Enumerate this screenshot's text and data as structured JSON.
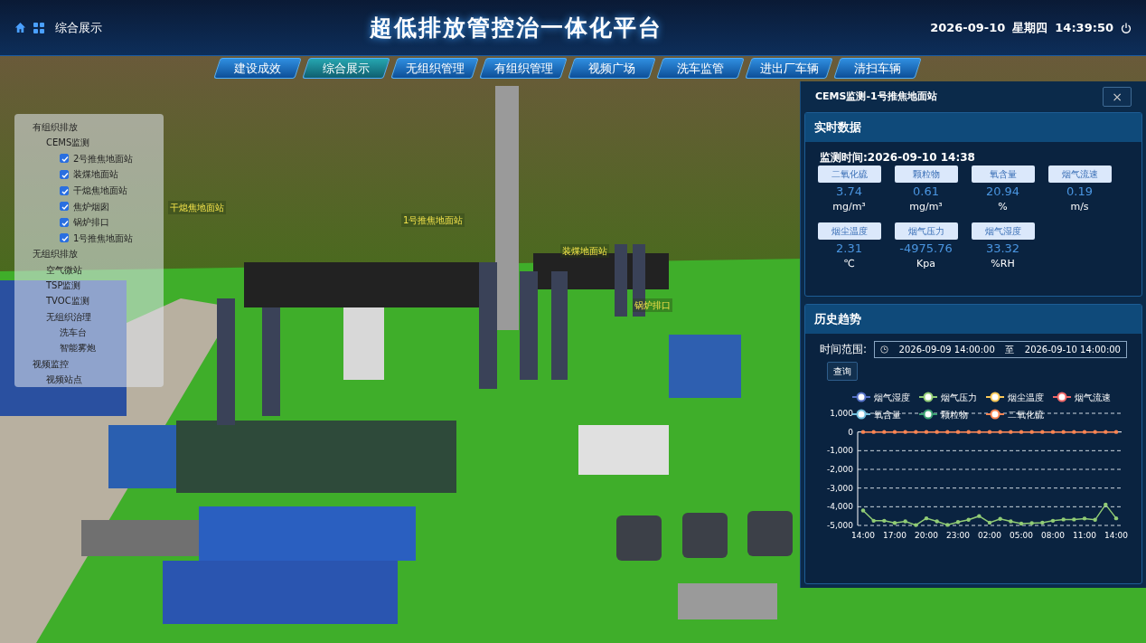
{
  "header": {
    "breadcrumb": "综合展示",
    "title": "超低排放管控治一体化平台",
    "date": "2026-09-10",
    "weekday": "星期四",
    "time": "14:39:50"
  },
  "nav_tabs": [
    {
      "label": "建设成效",
      "selected": false
    },
    {
      "label": "综合展示",
      "selected": true
    },
    {
      "label": "无组织管理",
      "selected": false
    },
    {
      "label": "有组织管理",
      "selected": false
    },
    {
      "label": "视频广场",
      "selected": false
    },
    {
      "label": "洗车监管",
      "selected": false
    },
    {
      "label": "进出厂车辆",
      "selected": false
    },
    {
      "label": "清扫车辆",
      "selected": false
    }
  ],
  "tree": [
    {
      "label": "有组织排放",
      "children": [
        {
          "label": "CEMS监测",
          "children": [
            {
              "label": "2号推焦地面站",
              "kind": "checkbox",
              "checked": true
            },
            {
              "label": "装煤地面站",
              "kind": "checkbox",
              "checked": true
            },
            {
              "label": "干熄焦地面站",
              "kind": "checkbox",
              "checked": true
            },
            {
              "label": "焦炉烟囱",
              "kind": "checkbox",
              "checked": true
            },
            {
              "label": "锅炉排口",
              "kind": "checkbox",
              "checked": true
            },
            {
              "label": "1号推焦地面站",
              "kind": "checkbox",
              "checked": true
            }
          ]
        }
      ]
    },
    {
      "label": "无组织排放",
      "children": [
        {
          "label": "空气微站"
        },
        {
          "label": "TSP监测"
        },
        {
          "label": "TVOC监测"
        },
        {
          "label": "无组织治理",
          "children": [
            {
              "label": "洗车台"
            },
            {
              "label": "智能雾炮"
            }
          ]
        }
      ]
    },
    {
      "label": "视频监控",
      "children": [
        {
          "label": "视频站点"
        }
      ]
    }
  ],
  "scene_labels": [
    {
      "label": "干熄焦地面站"
    },
    {
      "label": "1号推焦地面站"
    },
    {
      "label": "装煤地面站"
    },
    {
      "label": "锅炉排口"
    }
  ],
  "panel": {
    "title": "CEMS监测-1号推焦地面站",
    "close": "×",
    "realtime": {
      "heading": "实时数据",
      "time_label": "监测时间:2026-09-10 14:38",
      "metrics": [
        {
          "name": "二氧化硫",
          "value": "3.74",
          "unit": "mg/m³"
        },
        {
          "name": "颗粒物",
          "value": "0.61",
          "unit": "mg/m³"
        },
        {
          "name": "氧含量",
          "value": "20.94",
          "unit": "%"
        },
        {
          "name": "烟气流速",
          "value": "0.19",
          "unit": "m/s"
        },
        {
          "name": "烟尘温度",
          "value": "2.31",
          "unit": "℃"
        },
        {
          "name": "烟气压力",
          "value": "-4975.76",
          "unit": "Kpa"
        },
        {
          "name": "烟气湿度",
          "value": "33.32",
          "unit": "%RH"
        }
      ]
    },
    "history": {
      "heading": "历史趋势",
      "range_label": "时间范围:",
      "start": "2026-09-09 14:00:00",
      "separator": "至",
      "end": "2026-09-10 14:00:00",
      "query_button": "查询",
      "chart_data": {
        "type": "line",
        "categories": [
          "14:00",
          null,
          null,
          "17:00",
          null,
          null,
          "20:00",
          null,
          null,
          "23:00",
          null,
          null,
          "02:00",
          null,
          null,
          "05:00",
          null,
          null,
          "08:00",
          null,
          null,
          "11:00",
          null,
          null,
          "14:00"
        ],
        "grid": true,
        "legend": true,
        "yticks": [
          {
            "value": 1000,
            "label": "1,000"
          },
          {
            "value": 0,
            "label": "0"
          },
          {
            "value": -1000,
            "label": "-1,000"
          },
          {
            "value": -2000,
            "label": "-2,000"
          },
          {
            "value": -3000,
            "label": "-3,000"
          },
          {
            "value": -4000,
            "label": "-4,000"
          },
          {
            "value": -5000,
            "label": "-5,000"
          }
        ],
        "ylim": [
          -5000,
          1000
        ],
        "series": [
          {
            "name": "烟气湿度",
            "color": "#5470c6",
            "values": [
              null,
              null,
              null,
              null,
              null,
              null,
              null,
              null,
              null,
              null,
              null,
              null,
              null,
              null,
              null,
              null,
              null,
              null,
              null,
              null,
              null,
              null,
              null,
              null,
              null
            ]
          },
          {
            "name": "烟气压力",
            "color": "#91cc75",
            "values": [
              -4200,
              -4750,
              -4750,
              -4870,
              -4780,
              -4980,
              -4620,
              -4780,
              -4970,
              -4820,
              -4700,
              -4500,
              -4850,
              -4650,
              -4780,
              -4900,
              -4880,
              -4850,
              -4750,
              -4680,
              -4680,
              -4630,
              -4700,
              -3880,
              -4620
            ]
          },
          {
            "name": "烟尘温度",
            "color": "#fac858",
            "values": [
              null,
              null,
              null,
              null,
              null,
              null,
              null,
              null,
              null,
              null,
              null,
              null,
              null,
              null,
              null,
              null,
              null,
              null,
              null,
              null,
              null,
              null,
              null,
              null,
              null
            ]
          },
          {
            "name": "烟气流速",
            "color": "#ee6666",
            "values": [
              null,
              null,
              null,
              null,
              null,
              null,
              null,
              null,
              null,
              null,
              null,
              null,
              null,
              null,
              null,
              null,
              null,
              null,
              null,
              null,
              null,
              null,
              null,
              null,
              null
            ]
          },
          {
            "name": "氧含量",
            "color": "#73c0de",
            "values": [
              null,
              null,
              null,
              null,
              null,
              null,
              null,
              null,
              null,
              null,
              null,
              null,
              null,
              null,
              null,
              null,
              null,
              null,
              null,
              null,
              null,
              null,
              null,
              null,
              null
            ]
          },
          {
            "name": "颗粒物",
            "color": "#3ba272",
            "values": [
              null,
              null,
              null,
              null,
              null,
              null,
              null,
              null,
              null,
              null,
              null,
              null,
              null,
              null,
              null,
              null,
              null,
              null,
              null,
              null,
              null,
              null,
              null,
              null,
              null
            ]
          },
          {
            "name": "二氧化硫",
            "color": "#fc8452",
            "values": [
              0,
              0,
              0,
              0,
              0,
              0,
              0,
              0,
              0,
              0,
              0,
              0,
              0,
              0,
              0,
              0,
              0,
              0,
              0,
              0,
              0,
              0,
              0,
              0,
              0
            ]
          }
        ]
      }
    }
  }
}
